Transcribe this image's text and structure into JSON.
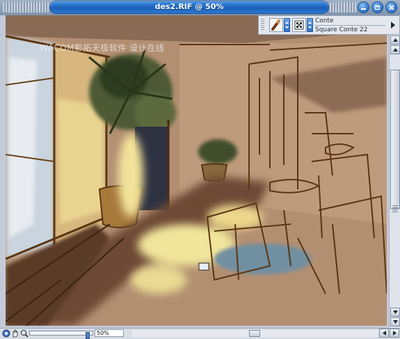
{
  "window": {
    "title": "des2.RIF @ 50%",
    "accent": "#1c5fb7"
  },
  "canvas": {
    "watermark": "WACOM影拓天极软件 设计在线"
  },
  "property_bar": {
    "brush_category": "Conte",
    "brush_variant": "Square Conte 22",
    "brush_icon": "conte-stick-icon",
    "variant_icon": "square-dab-icon"
  },
  "status_bar": {
    "zoom_value": "50%",
    "zoom_fraction": 0.95
  },
  "icons": {
    "minimize": "minimize-icon",
    "maximize": "maximize-icon",
    "close": "close-icon",
    "scroll_up": "arrow-up-icon",
    "scroll_down": "arrow-down-icon",
    "scroll_left": "arrow-left-icon",
    "scroll_right": "arrow-right-icon",
    "grabber_hand": "hand-grabber-icon",
    "zoom": "magnifier-icon",
    "color_mode": "color-circle-icon"
  }
}
